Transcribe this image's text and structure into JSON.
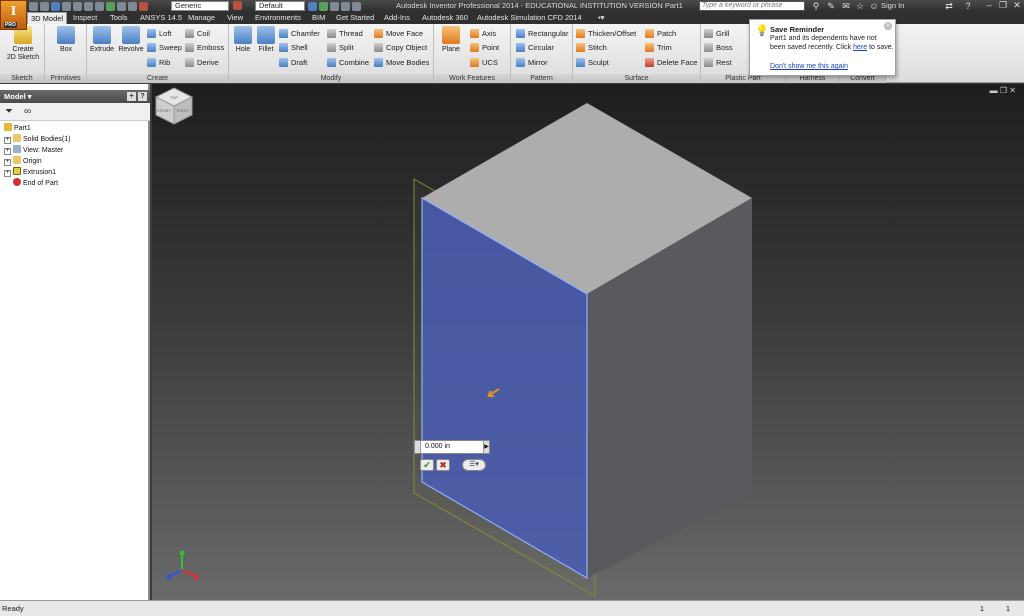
{
  "app": {
    "logo_letter": "I",
    "logo_badge": "PRO",
    "title": "Autodesk Inventor Professional 2014 - EDUCATIONAL INSTITUTION VERSION    Part1",
    "material_combo": "Generic",
    "appearance_combo": "Default",
    "search_placeholder": "Type a keyword or phrase",
    "sign_in": "Sign In"
  },
  "tabs": [
    "3D Model",
    "Inspect",
    "Tools",
    "ANSYS 14.5",
    "Manage",
    "View",
    "Environments",
    "BIM",
    "Get Started",
    "Add-Ins",
    "Autodesk 360",
    "Autodesk Simulation CFD 2014"
  ],
  "active_tab": "3D Model",
  "ribbon": {
    "sketch": {
      "title": "Sketch",
      "create_2d": "Create\n2D Sketch"
    },
    "primitives": {
      "title": "Primitives",
      "box": "Box"
    },
    "create": {
      "title": "Create",
      "extrude": "Extrude",
      "revolve": "Revolve",
      "loft": "Loft",
      "sweep": "Sweep",
      "rib": "Rib",
      "coil": "Coil",
      "emboss": "Emboss",
      "derive": "Derive"
    },
    "modify": {
      "title": "Modify",
      "hole": "Hole",
      "fillet": "Fillet",
      "chamfer": "Chamfer",
      "shell": "Shell",
      "draft": "Draft",
      "thread": "Thread",
      "split": "Split",
      "combine": "Combine",
      "move_face": "Move Face",
      "copy_object": "Copy Object",
      "move_bodies": "Move Bodies"
    },
    "work_features": {
      "title": "Work Features",
      "plane": "Plane",
      "axis": "Axis",
      "point": "Point",
      "ucs": "UCS"
    },
    "pattern": {
      "title": "Pattern",
      "rectangular": "Rectangular",
      "circular": "Circular",
      "mirror": "Mirror"
    },
    "surface": {
      "title": "Surface",
      "thicken": "Thicken/Offset",
      "stitch": "Stitch",
      "sculpt": "Sculpt",
      "patch": "Patch",
      "trim": "Trim",
      "delete_face": "Delete Face"
    },
    "plastic_part": {
      "title": "Plastic Part",
      "grill": "Grill",
      "boss": "Boss",
      "rest": "Rest"
    },
    "harness": {
      "title": "Harness"
    },
    "convert": {
      "title": "Convert"
    }
  },
  "tooltip": {
    "title": "Save Reminder",
    "body_pre": "Part1 and its dependents have not been saved recently. Click ",
    "link": "here",
    "body_post": " to save.",
    "dont_show": "Don't show me this again"
  },
  "browser": {
    "header": "Model ▾",
    "items": [
      {
        "label": "Part1",
        "level": 0,
        "expander": "",
        "icon": "part-icon"
      },
      {
        "label": "Solid Bodies(1)",
        "level": 1,
        "expander": "+",
        "icon": "folder-icon"
      },
      {
        "label": "View: Master",
        "level": 1,
        "expander": "+",
        "icon": "view-icon"
      },
      {
        "label": "Origin",
        "level": 1,
        "expander": "+",
        "icon": "folder-icon"
      },
      {
        "label": "Extrusion1",
        "level": 1,
        "expander": "+",
        "icon": "extrusion-icon"
      },
      {
        "label": "End of Part",
        "level": 1,
        "expander": "",
        "icon": "end-of-part-icon"
      }
    ]
  },
  "viewport": {
    "dimension_value": "0.000 in",
    "accent_selection": "#4a5cb0",
    "viewcube_labels": [
      "TOP",
      "FRONT",
      "RIGHT"
    ]
  },
  "status": {
    "text": "Ready",
    "count1": "1",
    "count2": "1"
  }
}
